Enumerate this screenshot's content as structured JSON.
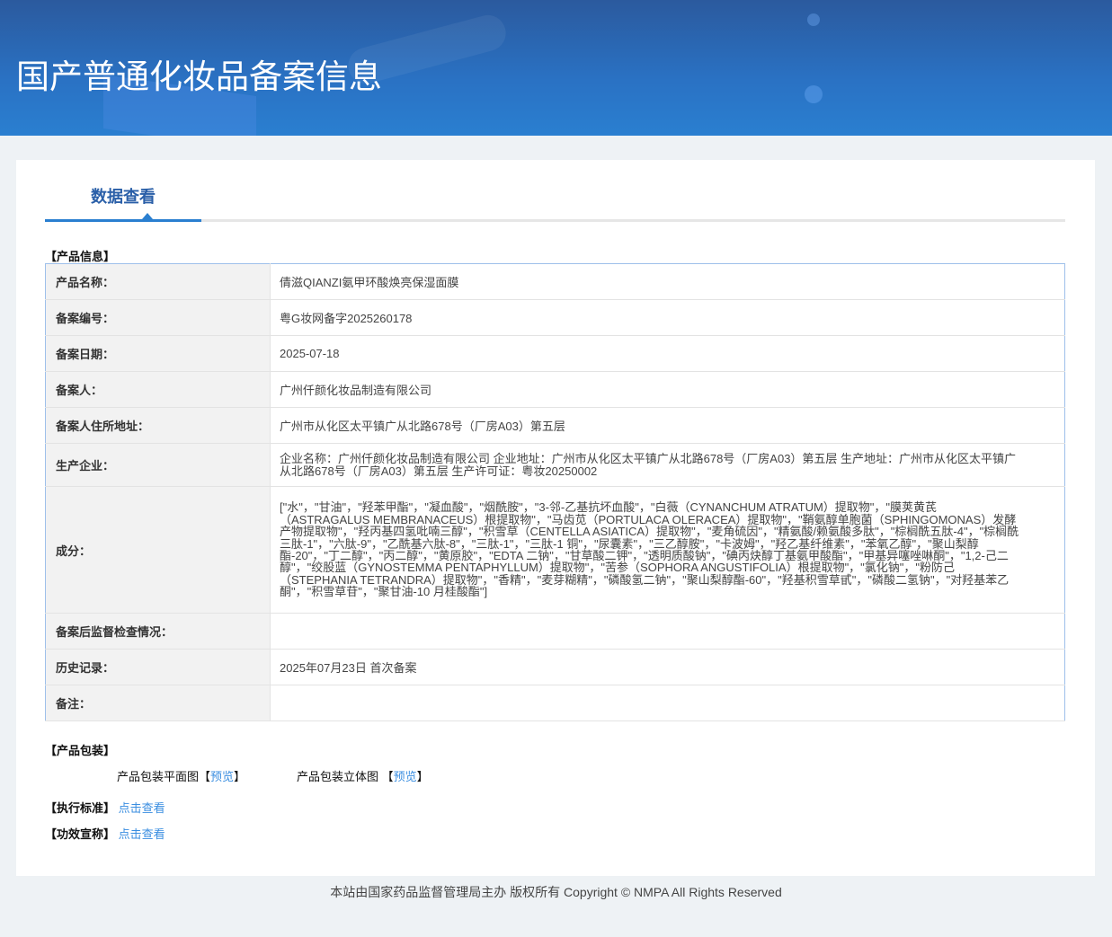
{
  "header": {
    "title": "国产普通化妆品备案信息"
  },
  "tab": {
    "label": "数据查看"
  },
  "product_info": {
    "section_label": "【产品信息】",
    "rows": [
      {
        "label": "产品名称：",
        "value": "倩滋QIANZI氨甲环酸焕亮保湿面膜"
      },
      {
        "label": "备案编号：",
        "value": "粤G妆网备字2025260178"
      },
      {
        "label": "备案日期：",
        "value": "2025-07-18"
      },
      {
        "label": "备案人：",
        "value": "广州仟颜化妆品制造有限公司"
      },
      {
        "label": "备案人住所地址：",
        "value": "广州市从化区太平镇广从北路678号（厂房A03）第五层"
      },
      {
        "label": "生产企业：",
        "value": "企业名称：广州仟颜化妆品制造有限公司 企业地址：广州市从化区太平镇广从北路678号（厂房A03）第五层 生产地址：广州市从化区太平镇广从北路678号（厂房A03）第五层 生产许可证：粤妆20250002"
      },
      {
        "label": "成分：",
        "value": "[\"水\"，\"甘油\"，\"羟苯甲酯\"，\"凝血酸\"，\"烟酰胺\"，\"3-邻-乙基抗坏血酸\"，\"白薇（CYNANCHUM ATRATUM）提取物\"，\"膜荚黄芪（ASTRAGALUS MEMBRANACEUS）根提取物\"，\"马齿苋（PORTULACA OLERACEA）提取物\"，\"鞘氨醇单胞菌（SPHINGOMONAS）发酵产物提取物\"，\"羟丙基四氢吡喃三醇\"，\"积雪草（CENTELLA ASIATICA）提取物\"，\"麦角硫因\"，\"精氨酸/赖氨酸多肽\"，\"棕榈酰五肽-4\"，\"棕榈酰三肽-1\"，\"六肽-9\"，\"乙酰基六肽-8\"，\"三肽-1\"，\"三肽-1 铜\"，\"尿囊素\"，\"三乙醇胺\"，\"卡波姆\"，\"羟乙基纤维素\"，\"苯氧乙醇\"，\"聚山梨醇酯-20\"，\"丁二醇\"，\"丙二醇\"，\"黄原胶\"，\"EDTA 二钠\"，\"甘草酸二钾\"，\"透明质酸钠\"，\"碘丙炔醇丁基氨甲酸酯\"，\"甲基异噻唑啉酮\"，\"1,2-己二醇\"，\"绞股蓝（GYNOSTEMMA PENTAPHYLLUM）提取物\"，\"苦参（SOPHORA ANGUSTIFOLIA）根提取物\"，\"氯化钠\"，\"粉防己（STEPHANIA TETRANDRA）提取物\"，\"香精\"，\"麦芽糊精\"，\"磷酸氢二钠\"，\"聚山梨醇酯-60\"，\"羟基积雪草甙\"，\"磷酸二氢钠\"，\"对羟基苯乙酮\"，\"积雪草苷\"，\"聚甘油-10 月桂酸酯\"]"
      },
      {
        "label": "备案后监督检查情况：",
        "value": ""
      },
      {
        "label": "历史记录：",
        "value": "2025年07月23日 首次备案"
      },
      {
        "label": "备注：",
        "value": ""
      }
    ]
  },
  "packaging": {
    "section_label": "【产品包装】",
    "flat_label": "产品包装平面图",
    "flat_link": "预览",
    "solid_label": "产品包装立体图",
    "solid_link": "预览",
    "lb": "【",
    "rb": "】"
  },
  "standard": {
    "label": "【执行标准】",
    "link": "点击查看"
  },
  "claims": {
    "label": "【功效宣称】",
    "link": "点击查看"
  },
  "footer": {
    "text": "本站由国家药品监督管理局主办 版权所有 Copyright © NMPA All Rights Reserved"
  }
}
